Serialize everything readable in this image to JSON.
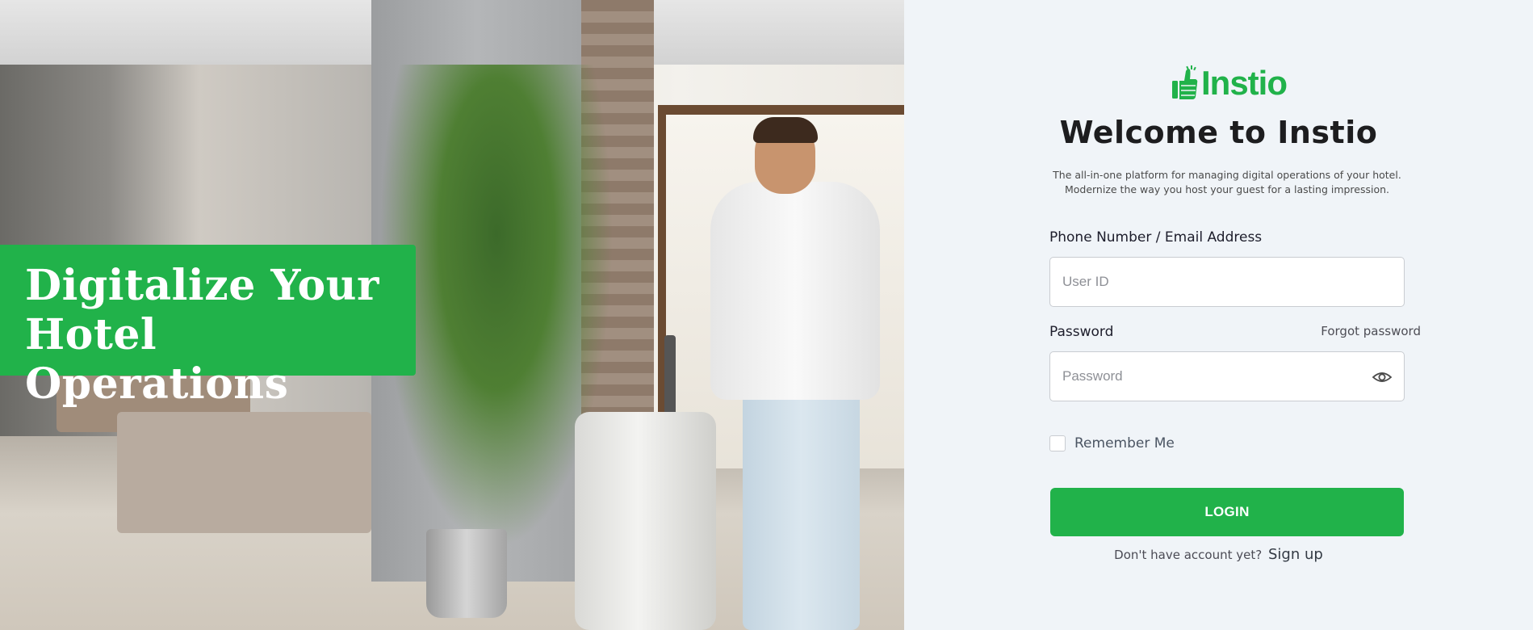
{
  "hero": {
    "banner_line1": "Digitalize Your",
    "banner_line2": "Hotel Operations",
    "banner_color": "#21b24a"
  },
  "brand": {
    "logo_text": "Instio",
    "logo_icon": "thumbs-up-icon",
    "brand_color": "#21b24a"
  },
  "login": {
    "title": "Welcome to Instio",
    "subtitle_line1": "The all-in-one platform for managing digital operations of your hotel.",
    "subtitle_line2": "Modernize the way you host your guest for a lasting impression.",
    "user_label": "Phone Number / Email Address",
    "user_placeholder": "User ID",
    "user_value": "",
    "password_label": "Password",
    "forgot_label": "Forgot password",
    "password_placeholder": "Password",
    "password_value": "",
    "password_toggle_icon": "eye-icon",
    "remember_label": "Remember Me",
    "remember_checked": false,
    "login_button": "LOGIN",
    "signup_prompt": "Don't have account yet?",
    "signup_link": "Sign up"
  }
}
